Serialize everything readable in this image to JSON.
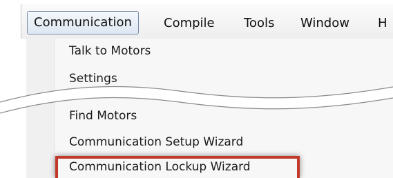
{
  "menubar": {
    "items": [
      {
        "label": "Communication",
        "active": true
      },
      {
        "label": "Compile"
      },
      {
        "label": "Tools"
      },
      {
        "label": "Window"
      },
      {
        "label": "H"
      }
    ]
  },
  "menu": {
    "items": [
      {
        "label": "Talk to Motors"
      },
      {
        "label": "Settings"
      },
      {
        "label": "Find Motors"
      },
      {
        "label": "Communication Setup Wizard"
      },
      {
        "label": "Communication Lockup Wizard",
        "highlighted": true
      }
    ],
    "highlight_color": "#c0392b"
  }
}
